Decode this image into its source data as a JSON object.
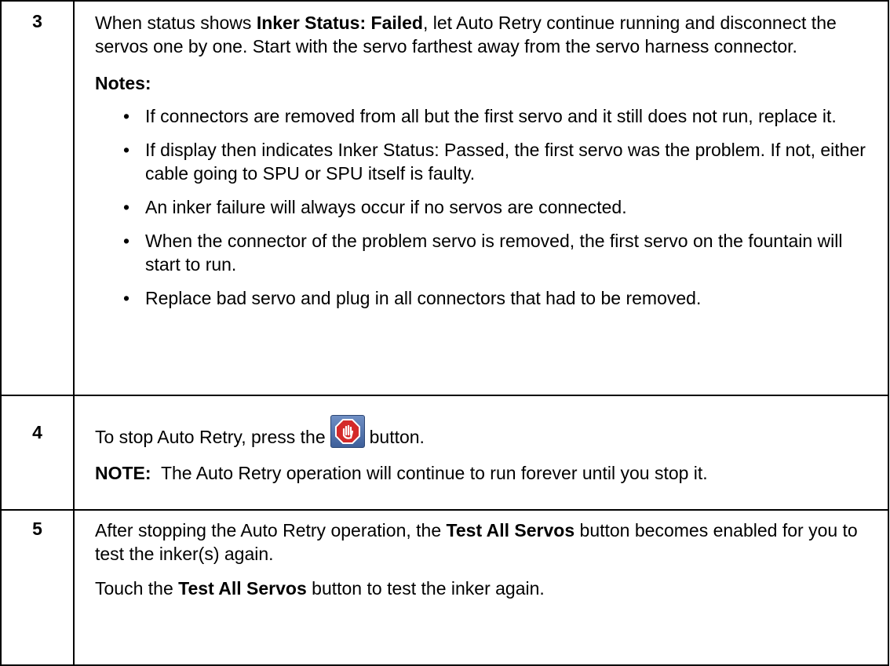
{
  "steps": [
    {
      "number": "3",
      "intro": {
        "pre": "When status shows ",
        "bold": "Inker Status: Failed",
        "post": ", let Auto Retry continue running and disconnect the servos one by one. Start with the servo farthest away from the servo harness connector."
      },
      "notes_label": "Notes:",
      "bullets": [
        "If connectors are removed from all but the first servo and it still does not run, replace it.",
        "If display then indicates Inker Status: Passed, the first servo was the problem. If not, either cable going to SPU or SPU itself is faulty.",
        "An inker failure will always occur if no servos are connected.",
        "When the connector of the problem servo is removed, the first servo on the fountain will start to run.",
        "Replace bad servo and plug in all connectors that had to be removed."
      ],
      "bullet_glyph": "•"
    },
    {
      "number": "4",
      "line1_pre": "To stop Auto Retry, press the",
      "line1_post": "button.",
      "stop_icon": "stop-hand-icon",
      "note_label": "NOTE:",
      "note_text": "The Auto Retry operation will continue to run forever until you stop it."
    },
    {
      "number": "5",
      "p1": {
        "pre": "After stopping the Auto Retry operation, the ",
        "bold": "Test All Servos",
        "post": " button becomes enabled for you to test the inker(s) again."
      },
      "p2": {
        "pre": "Touch the ",
        "bold": "Test All Servos",
        "post": " button to test the inker again."
      }
    }
  ],
  "colors": {
    "border": "#000000",
    "stop_icon_bg": "#4f6fa8",
    "stop_octagon": "#d42a2a"
  }
}
